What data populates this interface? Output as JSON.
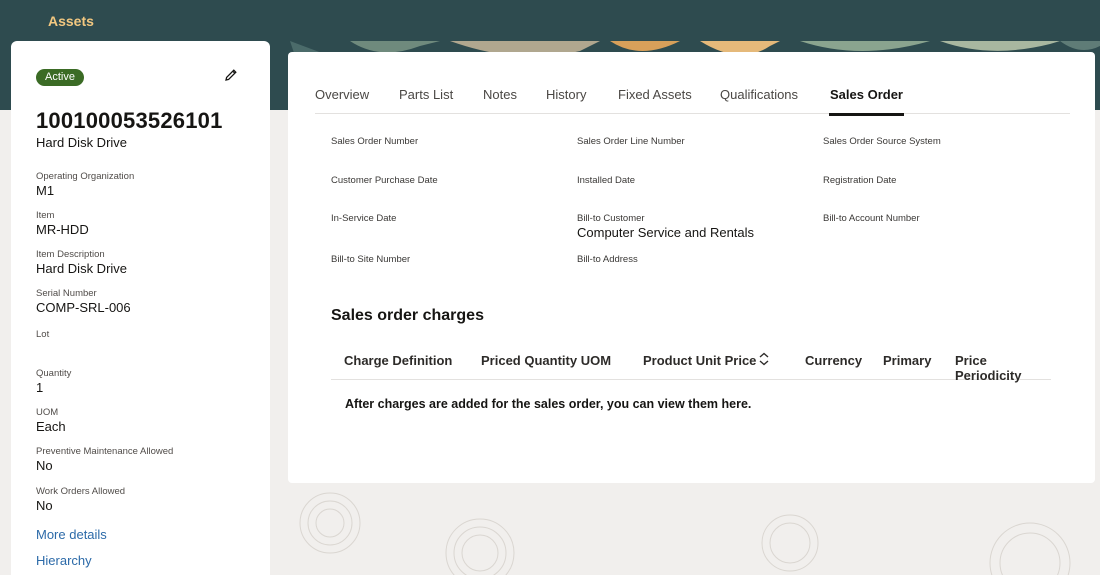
{
  "app": {
    "title": "Assets"
  },
  "asset": {
    "status": "Active",
    "number": "100100053526101",
    "description": "Hard Disk Drive",
    "fields": [
      {
        "label": "Operating Organization",
        "value": "M1"
      },
      {
        "label": "Item",
        "value": "MR-HDD"
      },
      {
        "label": "Item Description",
        "value": "Hard Disk Drive"
      },
      {
        "label": "Serial Number",
        "value": "COMP-SRL-006"
      },
      {
        "label": "Lot",
        "value": ""
      },
      {
        "label": "Quantity",
        "value": "1"
      },
      {
        "label": "UOM",
        "value": "Each"
      },
      {
        "label": "Preventive Maintenance Allowed",
        "value": "No"
      },
      {
        "label": "Work Orders Allowed",
        "value": "No"
      }
    ],
    "links": {
      "more_details": "More details",
      "hierarchy": "Hierarchy"
    }
  },
  "tabs": [
    "Overview",
    "Parts List",
    "Notes",
    "History",
    "Fixed Assets",
    "Qualifications",
    "Sales Order"
  ],
  "active_tab": "Sales Order",
  "sales_order": {
    "fields": [
      {
        "label": "Sales Order Number",
        "value": ""
      },
      {
        "label": "Sales Order Line Number",
        "value": ""
      },
      {
        "label": "Sales Order Source System",
        "value": ""
      },
      {
        "label": "Customer Purchase Date",
        "value": ""
      },
      {
        "label": "Installed Date",
        "value": ""
      },
      {
        "label": "Registration Date",
        "value": ""
      },
      {
        "label": "In-Service Date",
        "value": ""
      },
      {
        "label": "Bill-to Customer",
        "value": "Computer Service and Rentals"
      },
      {
        "label": "Bill-to Account Number",
        "value": ""
      },
      {
        "label": "Bill-to Site Number",
        "value": ""
      },
      {
        "label": "Bill-to Address",
        "value": ""
      }
    ]
  },
  "charges": {
    "title": "Sales order charges",
    "columns": [
      "Charge Definition",
      "Priced Quantity UOM",
      "Product Unit Price",
      "Currency",
      "Primary",
      "Price Periodicity"
    ],
    "empty_message": "After charges are added for the sales order, you can view them here."
  },
  "colors": {
    "header_bg": "#2e4b4f",
    "brand_text": "#f3c880",
    "active_badge": "#3b6b25",
    "link": "#2c6aa8"
  },
  "icons": {
    "edit": "pencil-icon",
    "sort": "sort-icon"
  }
}
